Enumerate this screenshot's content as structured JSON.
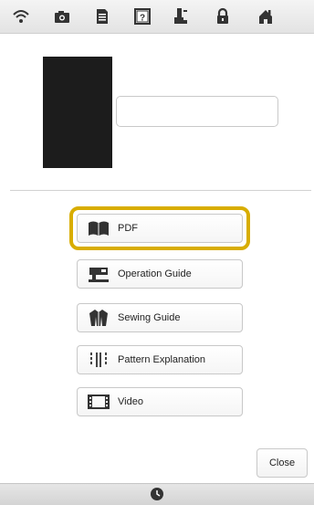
{
  "top_bar": {
    "icons": [
      "wifi-icon",
      "camera-icon",
      "document-icon",
      "help-icon",
      "presser-foot-icon",
      "lock-icon",
      "home-icon"
    ]
  },
  "preview": {
    "name_value": ""
  },
  "menu": {
    "items": [
      {
        "label": "PDF",
        "icon": "book-icon",
        "selected": true
      },
      {
        "label": "Operation Guide",
        "icon": "sewing-machine-icon"
      },
      {
        "label": "Sewing Guide",
        "icon": "garment-icon"
      },
      {
        "label": "Pattern Explanation",
        "icon": "stitch-pattern-icon"
      },
      {
        "label": "Video",
        "icon": "film-icon"
      }
    ]
  },
  "close_label": "Close",
  "colors": {
    "highlight": "#d8ad00",
    "topbar": "#e9e9e9",
    "bottombar": "#dcdcdc"
  }
}
